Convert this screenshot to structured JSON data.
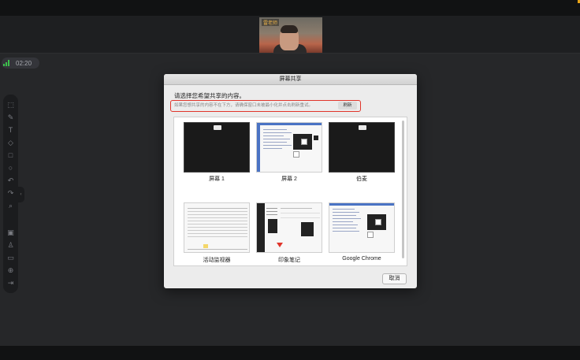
{
  "video": {
    "participant_name": "雷老师"
  },
  "timer": {
    "text": "02:20"
  },
  "dialog": {
    "title": "屏幕共享",
    "heading": "请选择您希望共享的内容。",
    "hint": "如果您想共享的内容不在下方，请确保窗口未被最小化并点击刷新重试。",
    "refresh_label": "刷新",
    "cancel_label": "取消",
    "sources": [
      {
        "label": "屏幕 1"
      },
      {
        "label": "屏幕 2"
      },
      {
        "label": "伯麦"
      },
      {
        "label": "活动监视器"
      },
      {
        "label": "印象笔记"
      },
      {
        "label": "Google Chrome"
      }
    ]
  },
  "colors": {
    "highlight": "#e0352b",
    "signal": "#3cc04b",
    "accent": "#e8a317"
  },
  "icons": [
    "signal-icon",
    "select-icon",
    "pen-icon",
    "text-icon",
    "eraser-icon",
    "rectangle-icon",
    "circle-icon",
    "undo-icon",
    "redo-icon",
    "zoom-icon",
    "briefcase-icon",
    "user-icon",
    "chat-icon",
    "plus-icon",
    "exit-icon"
  ]
}
